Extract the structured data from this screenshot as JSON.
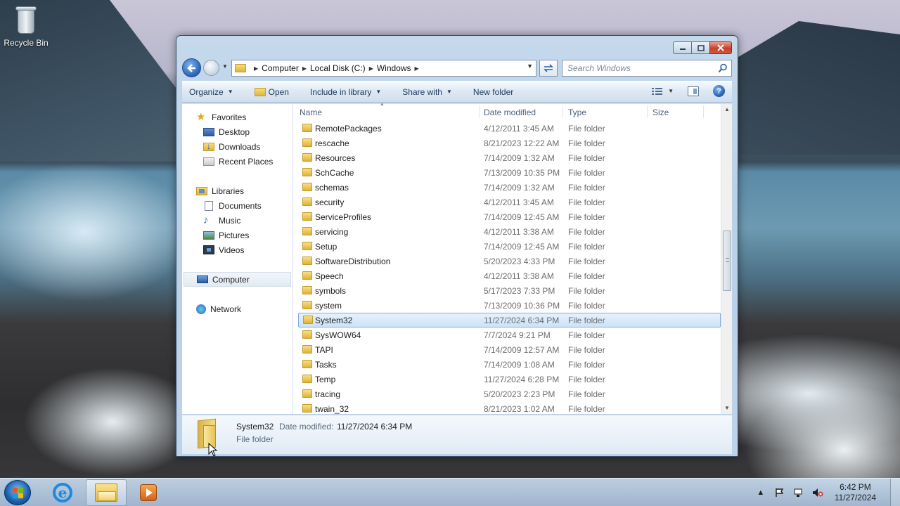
{
  "desktop": {
    "icons": [
      {
        "label": "Recycle Bin",
        "icon": "recycle-bin-icon"
      }
    ]
  },
  "window": {
    "caption_buttons": [
      "minimize",
      "maximize",
      "close"
    ],
    "address": {
      "crumbs": [
        "Computer",
        "Local Disk (C:)",
        "Windows"
      ]
    },
    "search": {
      "placeholder": "Search Windows"
    },
    "toolbar": {
      "organize": "Organize",
      "open": "Open",
      "include_in_library": "Include in library",
      "share_with": "Share with",
      "new_folder": "New folder"
    },
    "nav": {
      "favorites": "Favorites",
      "favorites_items": [
        "Desktop",
        "Downloads",
        "Recent Places"
      ],
      "libraries": "Libraries",
      "libraries_items": [
        "Documents",
        "Music",
        "Pictures",
        "Videos"
      ],
      "computer": "Computer",
      "network": "Network"
    },
    "columns": {
      "name": "Name",
      "date": "Date modified",
      "type": "Type",
      "size": "Size"
    },
    "files": [
      {
        "name": "RemotePackages",
        "date": "4/12/2011 3:45 AM",
        "type": "File folder"
      },
      {
        "name": "rescache",
        "date": "8/21/2023 12:22 AM",
        "type": "File folder"
      },
      {
        "name": "Resources",
        "date": "7/14/2009 1:32 AM",
        "type": "File folder"
      },
      {
        "name": "SchCache",
        "date": "7/13/2009 10:35 PM",
        "type": "File folder"
      },
      {
        "name": "schemas",
        "date": "7/14/2009 1:32 AM",
        "type": "File folder"
      },
      {
        "name": "security",
        "date": "4/12/2011 3:45 AM",
        "type": "File folder"
      },
      {
        "name": "ServiceProfiles",
        "date": "7/14/2009 12:45 AM",
        "type": "File folder"
      },
      {
        "name": "servicing",
        "date": "4/12/2011 3:38 AM",
        "type": "File folder"
      },
      {
        "name": "Setup",
        "date": "7/14/2009 12:45 AM",
        "type": "File folder"
      },
      {
        "name": "SoftwareDistribution",
        "date": "5/20/2023 4:33 PM",
        "type": "File folder"
      },
      {
        "name": "Speech",
        "date": "4/12/2011 3:38 AM",
        "type": "File folder"
      },
      {
        "name": "symbols",
        "date": "5/17/2023 7:33 PM",
        "type": "File folder"
      },
      {
        "name": "system",
        "date": "7/13/2009 10:36 PM",
        "type": "File folder"
      },
      {
        "name": "System32",
        "date": "11/27/2024 6:34 PM",
        "type": "File folder",
        "selected": true
      },
      {
        "name": "SysWOW64",
        "date": "7/7/2024 9:21 PM",
        "type": "File folder"
      },
      {
        "name": "TAPI",
        "date": "7/14/2009 12:57 AM",
        "type": "File folder"
      },
      {
        "name": "Tasks",
        "date": "7/14/2009 1:08 AM",
        "type": "File folder"
      },
      {
        "name": "Temp",
        "date": "11/27/2024 6:28 PM",
        "type": "File folder"
      },
      {
        "name": "tracing",
        "date": "5/20/2023 2:23 PM",
        "type": "File folder"
      },
      {
        "name": "twain_32",
        "date": "8/21/2023 1:02 AM",
        "type": "File folder"
      }
    ],
    "details": {
      "name": "System32",
      "date_label": "Date modified:",
      "date_value": "11/27/2024 6:34 PM",
      "type": "File folder"
    }
  },
  "taskbar": {
    "apps": [
      "internet-explorer",
      "windows-explorer",
      "windows-media-player"
    ],
    "active_app": "windows-explorer",
    "clock": {
      "time": "6:42 PM",
      "date": "11/27/2024"
    }
  },
  "colors": {
    "selection": "#cce3f9",
    "selection_border": "#84acdd",
    "close_button": "#c7402c",
    "folder": "#e2b43c"
  }
}
